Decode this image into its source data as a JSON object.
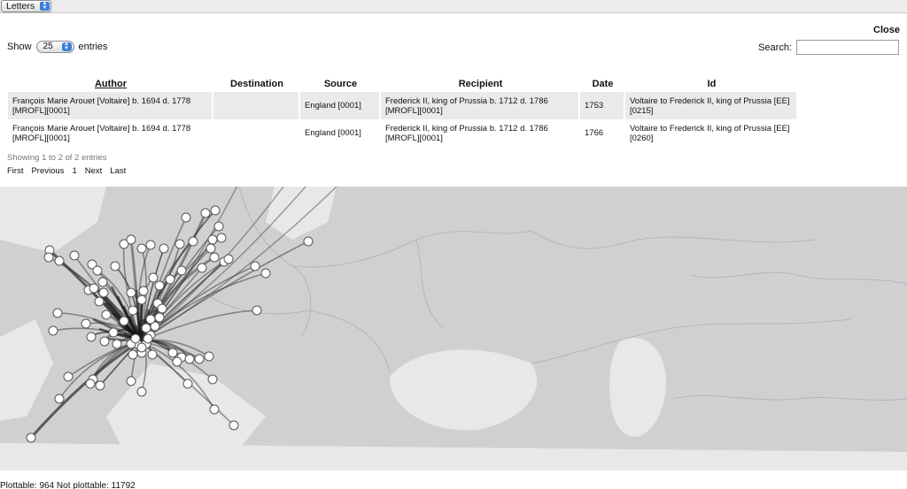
{
  "top": {
    "dataset_select": "Letters"
  },
  "close_label": "Close",
  "controls": {
    "show_label": "Show",
    "entries_value": "25",
    "entries_label": "entries",
    "search_label": "Search:",
    "search_value": ""
  },
  "table": {
    "columns": [
      "Author",
      "Destination",
      "Source",
      "Recipient",
      "Date",
      "Id"
    ],
    "rows": [
      {
        "author": "François Marie Arouet [Voltaire] b. 1694 d. 1778 [MROFL][0001]",
        "destination": "",
        "source": "England [0001]",
        "recipient": "Frederick II, king of Prussia b. 1712 d. 1786 [MROFL][0001]",
        "date": "1753",
        "id": "Voltaire to Frederick II, king of Prussia [EE] [0215]"
      },
      {
        "author": "François Marie Arouet [Voltaire] b. 1694 d. 1778 [MROFL][0001]",
        "destination": "",
        "source": "England [0001]",
        "recipient": "Frederick II, king of Prussia b. 1712 d. 1786 [MROFL][0001]",
        "date": "1766",
        "id": "Voltaire to Frederick II, king of Prussia [EE] [0260]"
      }
    ]
  },
  "info_text": "Showing 1 to 2 of 2 entries",
  "pagination": {
    "first": "First",
    "previous": "Previous",
    "page": "1",
    "next": "Next",
    "last": "Last"
  },
  "map": {
    "land_color": "#d0d0d0",
    "sea_color": "#e8e8e8",
    "line_color": "#333333",
    "node_color": "#ffffff"
  },
  "footer_text": "Plottable: 964 Not plottable: 11792"
}
